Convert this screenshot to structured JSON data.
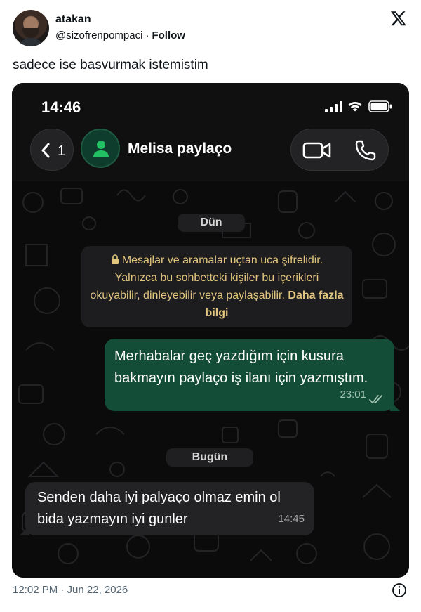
{
  "tweet": {
    "author_name": "atakan",
    "author_handle": "@sizofrenpompaci",
    "separator": "·",
    "follow_label": "Follow",
    "text": "sadece ise basvurmak istemistim",
    "timestamp": "12:02 PM · Jun 22, 2026",
    "icons": [
      "x-logo-icon",
      "info-icon"
    ]
  },
  "phone": {
    "status_time": "14:46",
    "back_count": "1",
    "contact_name": "Melisa paylaço",
    "date_divider_1": "Dün",
    "date_divider_2": "Bugün",
    "system_message": {
      "text": "Mesajlar ve aramalar uçtan uca şifrelidir. Yalnızca bu sohbetteki kişiler bu içerikleri okuyabilir, dinleyebilir veya paylaşabilir.",
      "link": "Daha fazla bilgi"
    },
    "messages": [
      {
        "direction": "outgoing",
        "text": "Merhabalar geç yazdığım için kusura bakmayın paylaço iş ilanı için yazmıştım.",
        "time": "23:01",
        "status": "read"
      },
      {
        "direction": "incoming",
        "text": "Senden daha iyi palyaço olmaz emin ol bida yazmayın iyi gunler",
        "time": "14:45"
      }
    ],
    "colors": {
      "outgoing_bubble": "#134d37",
      "incoming_bubble": "#232325",
      "system_text": "#e2c67e",
      "accent_green": "#21c063"
    }
  }
}
